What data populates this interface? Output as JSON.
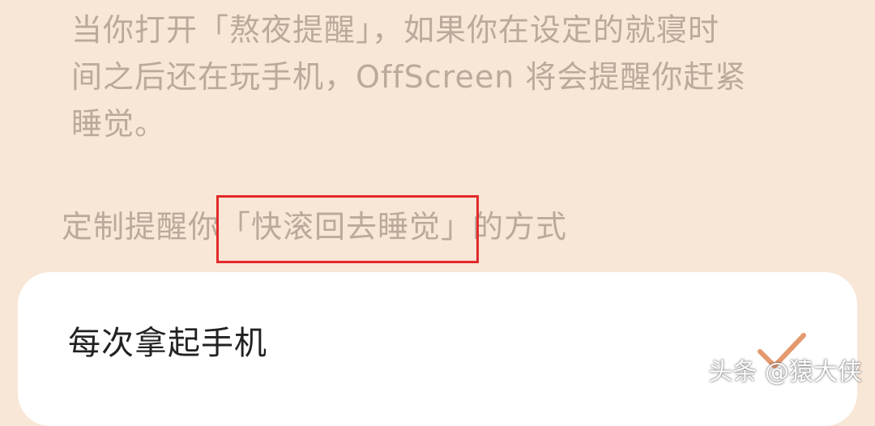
{
  "description": {
    "line1": "当你打开「熬夜提醒」，如果你在设定的就寝时",
    "line2": "间之后还在玩手机，OffScreen 将会提醒你赶紧",
    "line3": "睡觉。"
  },
  "section": {
    "prefix": "定制提醒你",
    "highlight": "「快滚回去睡觉」",
    "suffix": "的方式"
  },
  "options": [
    {
      "label": "每次拿起手机",
      "selected": true,
      "icon": "check-icon"
    }
  ],
  "watermark": "头条 @猿大侠",
  "colors": {
    "background": "#f8e6d6",
    "muted_text": "#b9aa9c",
    "highlight_box": "#e22a2a",
    "check": "#e49a6e"
  }
}
